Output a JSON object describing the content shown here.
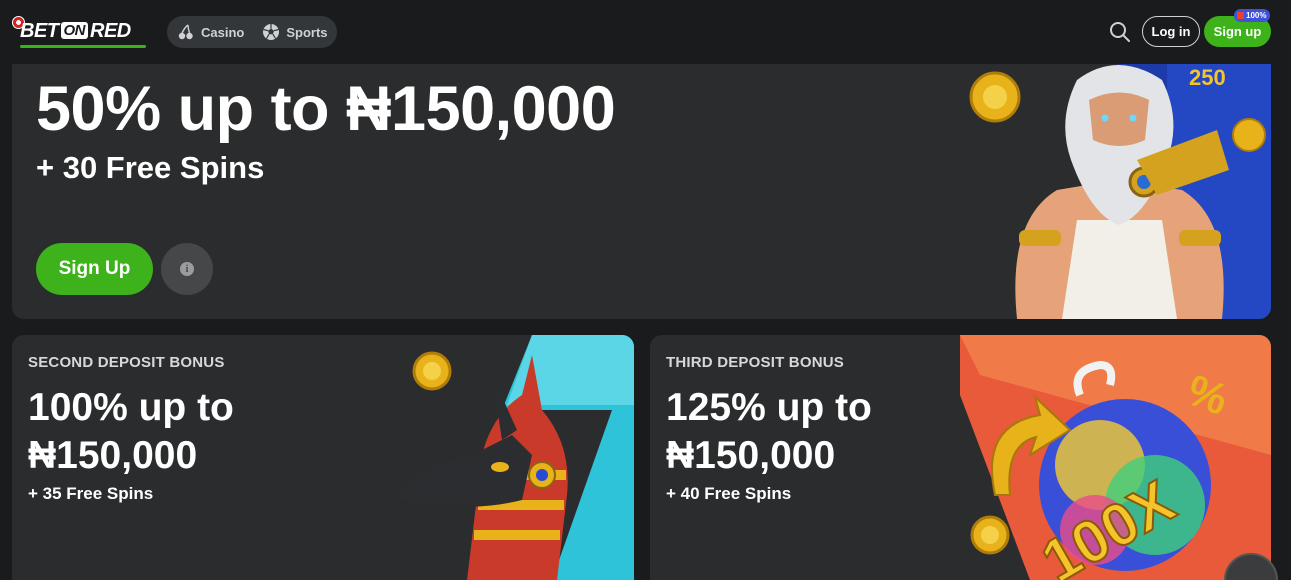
{
  "header": {
    "logo": "BETONRED",
    "nav": [
      {
        "label": "Casino",
        "icon": "cherry-icon"
      },
      {
        "label": "Sports",
        "icon": "soccer-ball-icon"
      }
    ],
    "login_label": "Log in",
    "signup_label": "Sign up",
    "signup_badge": "100%"
  },
  "hero": {
    "title": "50% up to ₦150,000",
    "subtitle": "+ 30 Free Spins",
    "signup_label": "Sign Up",
    "info_label": "i"
  },
  "cards": [
    {
      "label": "SECOND DEPOSIT BONUS",
      "title_line1": "100% up to",
      "title_line2": "₦150,000",
      "spins": "+ 35 Free Spins"
    },
    {
      "label": "THIRD DEPOSIT BONUS",
      "title_line1": "125% up to",
      "title_line2": "₦150,000",
      "spins": "+ 40 Free Spins"
    }
  ],
  "colors": {
    "background": "#1a1b1d",
    "card": "#2a2c2d",
    "accent_green": "#3db21a",
    "nav_pill": "#34373a",
    "badge_blue": "#3f51d9"
  }
}
